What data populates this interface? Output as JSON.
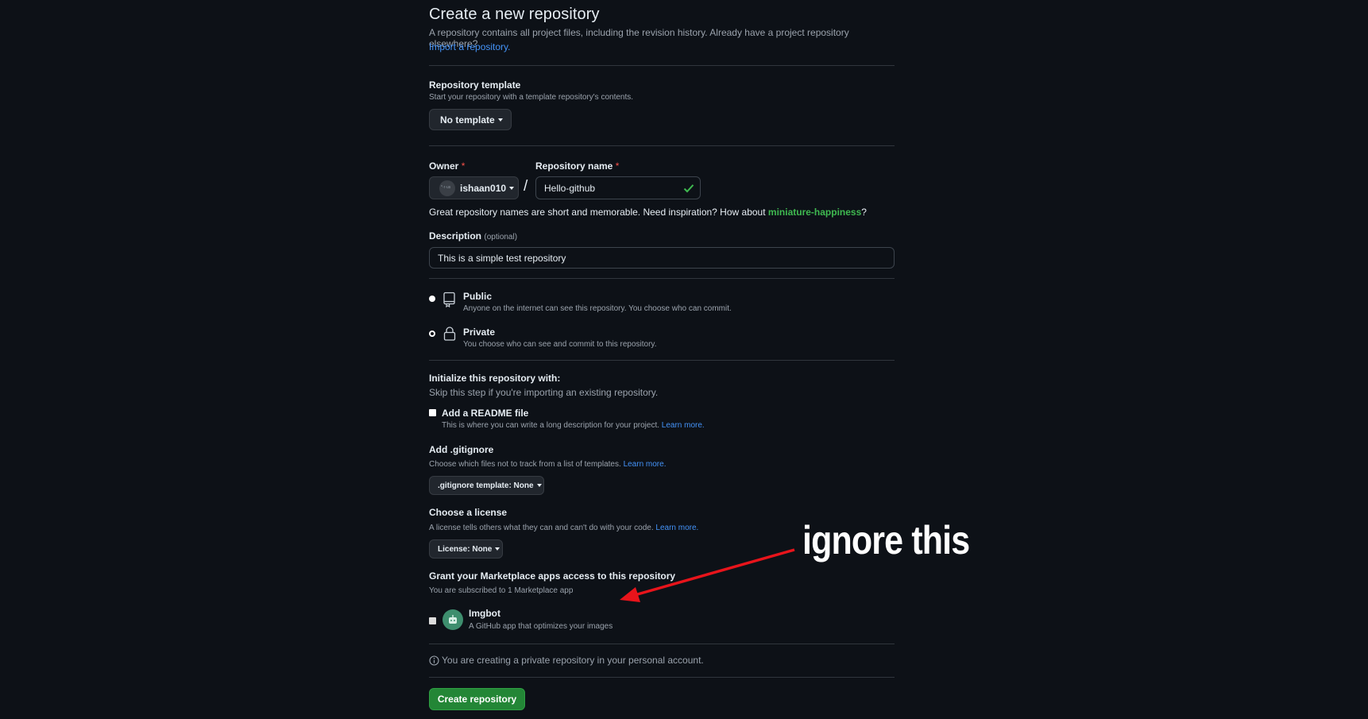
{
  "header": {
    "title": "Create a new repository",
    "subtitle": "A repository contains all project files, including the revision history. Already have a project repository elsewhere?",
    "import_link": "Import a repository."
  },
  "template": {
    "label": "Repository template",
    "note": "Start your repository with a template repository's contents.",
    "button": "No template"
  },
  "owner": {
    "label": "Owner",
    "required_mark": "*",
    "value": "ishaan010",
    "avatar_text": "*·r·us"
  },
  "repo_name": {
    "label": "Repository name",
    "required_mark": "*",
    "value": "Hello-github",
    "separator": "/"
  },
  "name_hint": {
    "text": "Great repository names are short and memorable. Need inspiration? How about",
    "suggestion": "miniature-happiness",
    "end": "?"
  },
  "description": {
    "label": "Description",
    "optional": "(optional)",
    "value": "This is a simple test repository"
  },
  "visibility": {
    "public": {
      "label": "Public",
      "note": "Anyone on the internet can see this repository. You choose who can commit."
    },
    "private": {
      "label": "Private",
      "note": "You choose who can see and commit to this repository."
    },
    "selected": "private"
  },
  "initialize": {
    "label": "Initialize this repository with:",
    "note": "Skip this step if you're importing an existing repository.",
    "readme_label": "Add a README file",
    "readme_note": "This is where you can write a long description for your project.",
    "learn_more": "Learn more."
  },
  "gitignore": {
    "label": "Add .gitignore",
    "note": "Choose which files not to track from a list of templates.",
    "learn_more": "Learn more.",
    "button": ".gitignore template: None"
  },
  "license": {
    "label": "Choose a license",
    "note": "A license tells others what they can and can't do with your code.",
    "learn_more": "Learn more.",
    "button": "License: None"
  },
  "marketplace": {
    "label": "Grant your Marketplace apps access to this repository",
    "note": "You are subscribed to 1 Marketplace app",
    "app_name": "Imgbot",
    "app_note": "A GitHub app that optimizes your images"
  },
  "info": {
    "text": "You are creating a private repository in your personal account."
  },
  "submit": {
    "label": "Create repository"
  },
  "annotation": {
    "text": "ignore this",
    "color": "#e8141b"
  }
}
